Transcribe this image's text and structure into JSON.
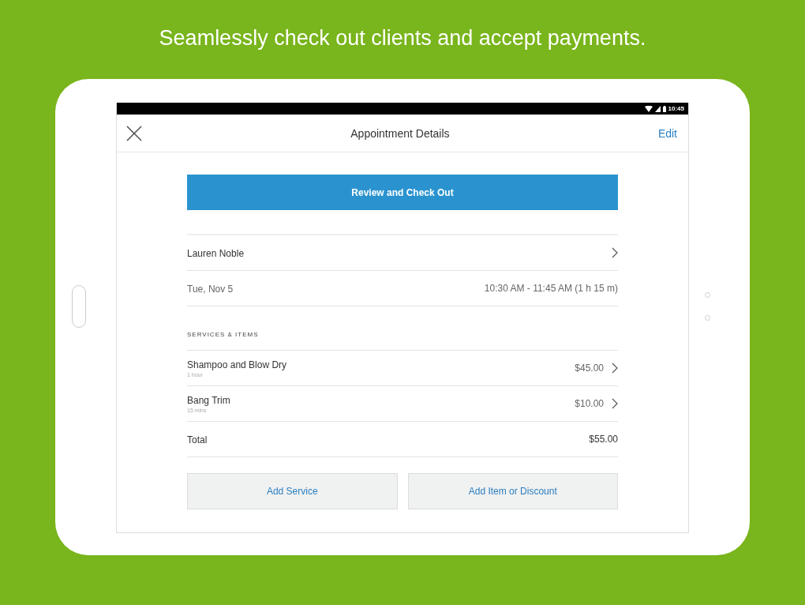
{
  "headline": "Seamlessly check out clients and accept payments.",
  "status_bar": {
    "time": "10:45"
  },
  "header": {
    "title": "Appointment Details",
    "action": "Edit"
  },
  "primary_button": "Review and Check Out",
  "client": {
    "name": "Lauren Noble"
  },
  "schedule": {
    "date": "Tue, Nov 5",
    "time": "10:30 AM - 11:45 AM (1 h 15 m)"
  },
  "section_title": "SERVICES & ITEMS",
  "items": [
    {
      "name": "Shampoo and Blow Dry",
      "duration": "1 hour",
      "price": "$45.00"
    },
    {
      "name": "Bang Trim",
      "duration": "15 mins",
      "price": "$10.00"
    }
  ],
  "total": {
    "label": "Total",
    "amount": "$55.00"
  },
  "buttons": [
    "Add Service",
    "Add Item or Discount"
  ]
}
